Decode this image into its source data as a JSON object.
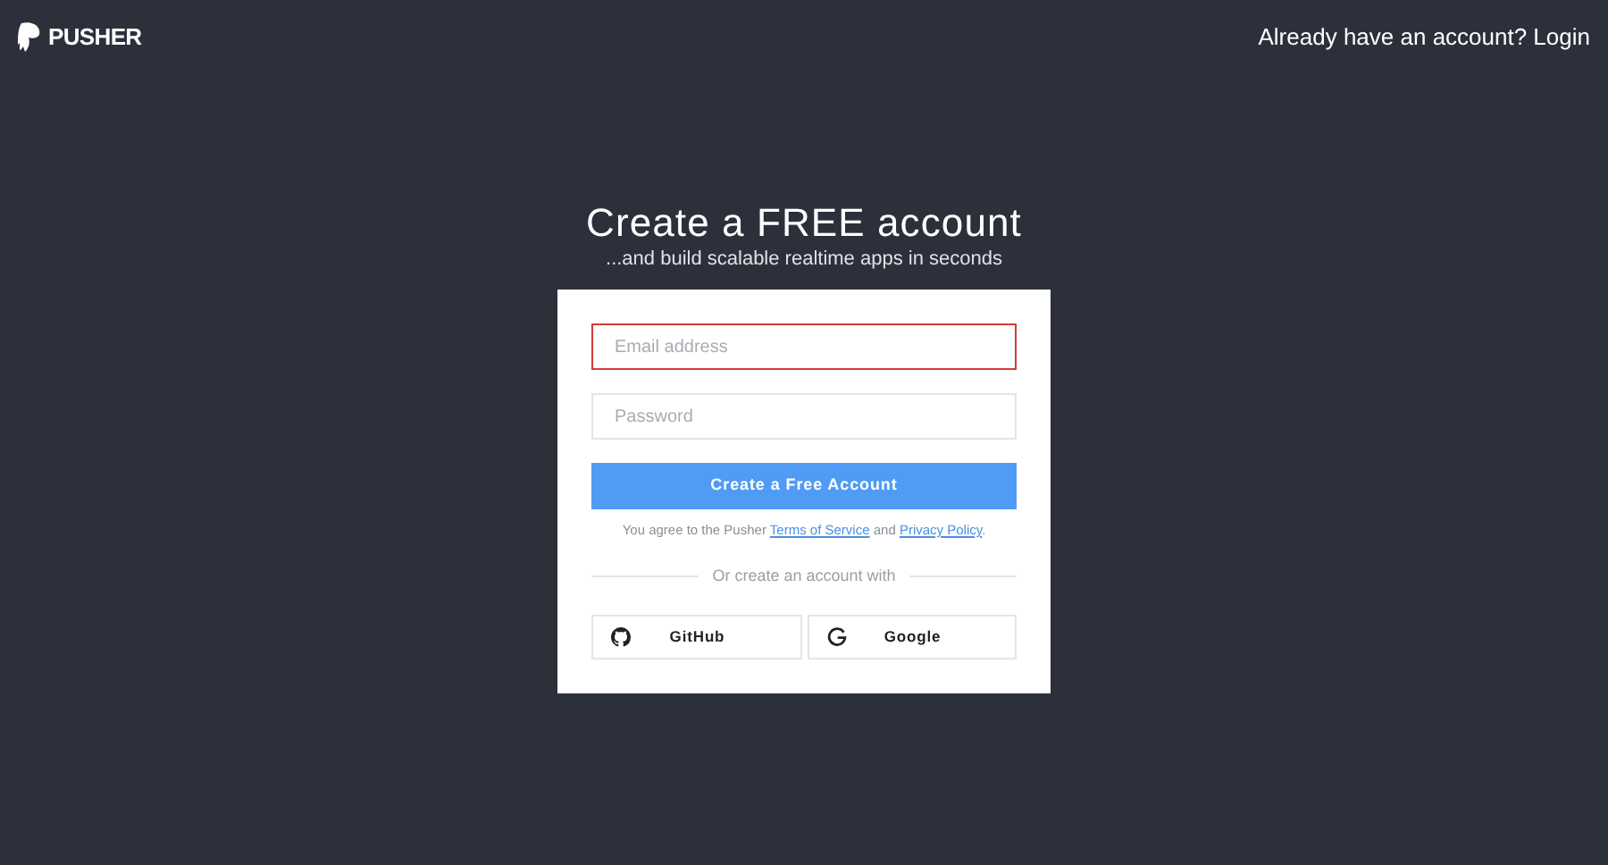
{
  "header": {
    "logo_text": "PUSHER",
    "login_link": "Already have an account? Login"
  },
  "hero": {
    "title": "Create a FREE account",
    "subtitle": "...and build scalable realtime apps in seconds"
  },
  "form": {
    "fields": [
      {
        "placeholder": "Email address",
        "error": true
      },
      {
        "placeholder": "Password",
        "error": false
      }
    ],
    "submit": "Create a Free Account",
    "agreement": {
      "prefix": "You agree to the Pusher ",
      "terms_link": "Terms of Service",
      "middle": " and ",
      "privacy_link": "Privacy Policy",
      "suffix": "."
    },
    "divider_text": "Or create an account with",
    "providers": [
      {
        "label": "GitHub",
        "kind": "github"
      },
      {
        "label": "Google",
        "kind": "google"
      }
    ]
  }
}
